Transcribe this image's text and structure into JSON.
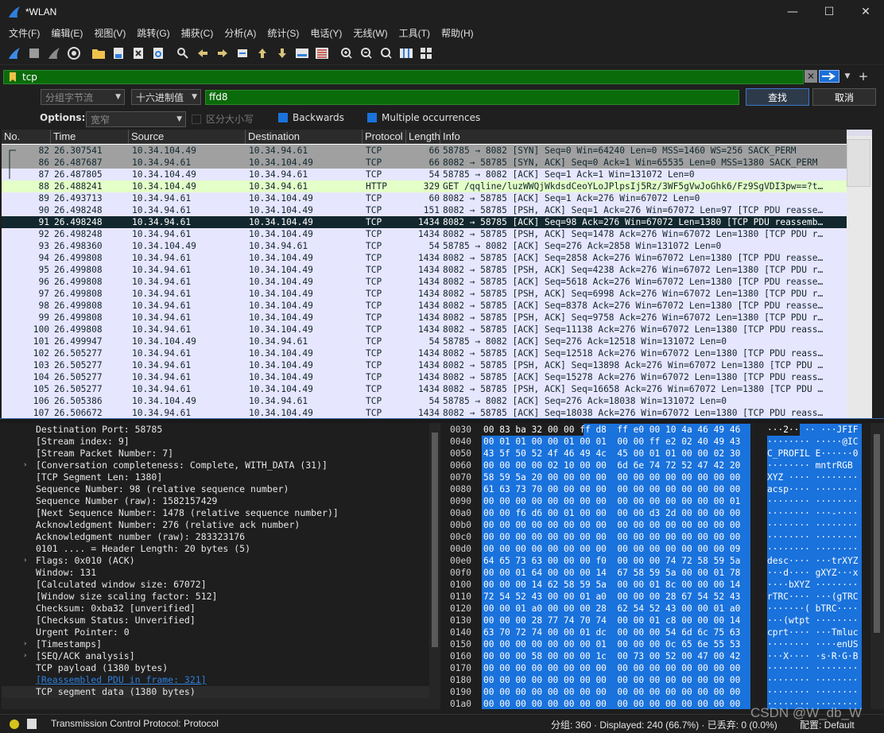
{
  "window": {
    "title": "*WLAN",
    "minimize": "—",
    "maximize": "☐",
    "close": "✕"
  },
  "menu": [
    "文件(F)",
    "编辑(E)",
    "视图(V)",
    "跳转(G)",
    "捕获(C)",
    "分析(A)",
    "统计(S)",
    "电话(Y)",
    "无线(W)",
    "工具(T)",
    "帮助(H)"
  ],
  "filter": {
    "value": "tcp"
  },
  "find": {
    "scope": "分组字节流",
    "type": "十六进制值",
    "value": "ffd8",
    "find_btn": "查找",
    "cancel_btn": "取消",
    "options_label": "Options:",
    "charset": "宽窄",
    "case_label": "区分大小写",
    "backwards_label": "Backwards",
    "multiple_label": "Multiple occurrences"
  },
  "columns": [
    "No.",
    "Time",
    "Source",
    "Destination",
    "Protocol",
    "Length",
    "Info"
  ],
  "packets": [
    {
      "no": "82",
      "time": "26.307541",
      "src": "10.34.104.49",
      "dst": "10.34.94.61",
      "proto": "TCP",
      "len": "66",
      "info": "58785 → 8082 [SYN] Seq=0 Win=64240 Len=0 MSS=1460 WS=256 SACK_PERM",
      "style": "gray"
    },
    {
      "no": "86",
      "time": "26.487687",
      "src": "10.34.94.61",
      "dst": "10.34.104.49",
      "proto": "TCP",
      "len": "66",
      "info": "8082 → 58785 [SYN, ACK] Seq=0 Ack=1 Win=65535 Len=0 MSS=1380 SACK_PERM",
      "style": "gray"
    },
    {
      "no": "87",
      "time": "26.487805",
      "src": "10.34.104.49",
      "dst": "10.34.94.61",
      "proto": "TCP",
      "len": "54",
      "info": "58785 → 8082 [ACK] Seq=1 Ack=1 Win=131072 Len=0",
      "style": "tcp"
    },
    {
      "no": "88",
      "time": "26.488241",
      "src": "10.34.104.49",
      "dst": "10.34.94.61",
      "proto": "HTTP",
      "len": "329",
      "info": "GET /qqline/luzWWQjWkdsdCeoYLoJPlpsIj5Rz/3WF5gVwJoGhk6/Fz9SgVDI3pw==?t…",
      "style": "http"
    },
    {
      "no": "89",
      "time": "26.493713",
      "src": "10.34.94.61",
      "dst": "10.34.104.49",
      "proto": "TCP",
      "len": "60",
      "info": "8082 → 58785 [ACK] Seq=1 Ack=276 Win=67072 Len=0",
      "style": "tcp"
    },
    {
      "no": "90",
      "time": "26.498248",
      "src": "10.34.94.61",
      "dst": "10.34.104.49",
      "proto": "TCP",
      "len": "151",
      "info": "8082 → 58785 [PSH, ACK] Seq=1 Ack=276 Win=67072 Len=97 [TCP PDU reasse…",
      "style": "tcp"
    },
    {
      "no": "91",
      "time": "26.498248",
      "src": "10.34.94.61",
      "dst": "10.34.104.49",
      "proto": "TCP",
      "len": "1434",
      "info": "8082 → 58785 [ACK] Seq=98 Ack=276 Win=67072 Len=1380 [TCP PDU reassemb…",
      "style": "selected"
    },
    {
      "no": "92",
      "time": "26.498248",
      "src": "10.34.94.61",
      "dst": "10.34.104.49",
      "proto": "TCP",
      "len": "1434",
      "info": "8082 → 58785 [PSH, ACK] Seq=1478 Ack=276 Win=67072 Len=1380 [TCP PDU r…",
      "style": "tcp"
    },
    {
      "no": "93",
      "time": "26.498360",
      "src": "10.34.104.49",
      "dst": "10.34.94.61",
      "proto": "TCP",
      "len": "54",
      "info": "58785 → 8082 [ACK] Seq=276 Ack=2858 Win=131072 Len=0",
      "style": "tcp"
    },
    {
      "no": "94",
      "time": "26.499808",
      "src": "10.34.94.61",
      "dst": "10.34.104.49",
      "proto": "TCP",
      "len": "1434",
      "info": "8082 → 58785 [ACK] Seq=2858 Ack=276 Win=67072 Len=1380 [TCP PDU reasse…",
      "style": "tcp"
    },
    {
      "no": "95",
      "time": "26.499808",
      "src": "10.34.94.61",
      "dst": "10.34.104.49",
      "proto": "TCP",
      "len": "1434",
      "info": "8082 → 58785 [PSH, ACK] Seq=4238 Ack=276 Win=67072 Len=1380 [TCP PDU r…",
      "style": "tcp"
    },
    {
      "no": "96",
      "time": "26.499808",
      "src": "10.34.94.61",
      "dst": "10.34.104.49",
      "proto": "TCP",
      "len": "1434",
      "info": "8082 → 58785 [ACK] Seq=5618 Ack=276 Win=67072 Len=1380 [TCP PDU reasse…",
      "style": "tcp"
    },
    {
      "no": "97",
      "time": "26.499808",
      "src": "10.34.94.61",
      "dst": "10.34.104.49",
      "proto": "TCP",
      "len": "1434",
      "info": "8082 → 58785 [PSH, ACK] Seq=6998 Ack=276 Win=67072 Len=1380 [TCP PDU r…",
      "style": "tcp"
    },
    {
      "no": "98",
      "time": "26.499808",
      "src": "10.34.94.61",
      "dst": "10.34.104.49",
      "proto": "TCP",
      "len": "1434",
      "info": "8082 → 58785 [ACK] Seq=8378 Ack=276 Win=67072 Len=1380 [TCP PDU reasse…",
      "style": "tcp"
    },
    {
      "no": "99",
      "time": "26.499808",
      "src": "10.34.94.61",
      "dst": "10.34.104.49",
      "proto": "TCP",
      "len": "1434",
      "info": "8082 → 58785 [PSH, ACK] Seq=9758 Ack=276 Win=67072 Len=1380 [TCP PDU r…",
      "style": "tcp"
    },
    {
      "no": "100",
      "time": "26.499808",
      "src": "10.34.94.61",
      "dst": "10.34.104.49",
      "proto": "TCP",
      "len": "1434",
      "info": "8082 → 58785 [ACK] Seq=11138 Ack=276 Win=67072 Len=1380 [TCP PDU reass…",
      "style": "tcp"
    },
    {
      "no": "101",
      "time": "26.499947",
      "src": "10.34.104.49",
      "dst": "10.34.94.61",
      "proto": "TCP",
      "len": "54",
      "info": "58785 → 8082 [ACK] Seq=276 Ack=12518 Win=131072 Len=0",
      "style": "tcp"
    },
    {
      "no": "102",
      "time": "26.505277",
      "src": "10.34.94.61",
      "dst": "10.34.104.49",
      "proto": "TCP",
      "len": "1434",
      "info": "8082 → 58785 [ACK] Seq=12518 Ack=276 Win=67072 Len=1380 [TCP PDU reass…",
      "style": "tcp"
    },
    {
      "no": "103",
      "time": "26.505277",
      "src": "10.34.94.61",
      "dst": "10.34.104.49",
      "proto": "TCP",
      "len": "1434",
      "info": "8082 → 58785 [PSH, ACK] Seq=13898 Ack=276 Win=67072 Len=1380 [TCP PDU …",
      "style": "tcp"
    },
    {
      "no": "104",
      "time": "26.505277",
      "src": "10.34.94.61",
      "dst": "10.34.104.49",
      "proto": "TCP",
      "len": "1434",
      "info": "8082 → 58785 [ACK] Seq=15278 Ack=276 Win=67072 Len=1380 [TCP PDU reass…",
      "style": "tcp"
    },
    {
      "no": "105",
      "time": "26.505277",
      "src": "10.34.94.61",
      "dst": "10.34.104.49",
      "proto": "TCP",
      "len": "1434",
      "info": "8082 → 58785 [PSH, ACK] Seq=16658 Ack=276 Win=67072 Len=1380 [TCP PDU …",
      "style": "tcp"
    },
    {
      "no": "106",
      "time": "26.505386",
      "src": "10.34.104.49",
      "dst": "10.34.94.61",
      "proto": "TCP",
      "len": "54",
      "info": "58785 → 8082 [ACK] Seq=276 Ack=18038 Win=131072 Len=0",
      "style": "tcp"
    },
    {
      "no": "107",
      "time": "26.506672",
      "src": "10.34.94.61",
      "dst": "10.34.104.49",
      "proto": "TCP",
      "len": "1434",
      "info": "8082 → 58785 [ACK] Seq=18038 Ack=276 Win=67072 Len=1380 [TCP PDU reass…",
      "style": "tcp"
    }
  ],
  "details": [
    {
      "text": "Destination Port: 58785",
      "exp": ""
    },
    {
      "text": "[Stream index: 9]",
      "exp": ""
    },
    {
      "text": "[Stream Packet Number: 7]",
      "exp": ""
    },
    {
      "text": "[Conversation completeness: Complete, WITH_DATA (31)]",
      "exp": "›"
    },
    {
      "text": "[TCP Segment Len: 1380]",
      "exp": ""
    },
    {
      "text": "Sequence Number: 98    (relative sequence number)",
      "exp": ""
    },
    {
      "text": "Sequence Number (raw): 1582157429",
      "exp": ""
    },
    {
      "text": "[Next Sequence Number: 1478    (relative sequence number)]",
      "exp": ""
    },
    {
      "text": "Acknowledgment Number: 276    (relative ack number)",
      "exp": ""
    },
    {
      "text": "Acknowledgment number (raw): 283323176",
      "exp": ""
    },
    {
      "text": "0101 .... = Header Length: 20 bytes (5)",
      "exp": ""
    },
    {
      "text": "Flags: 0x010 (ACK)",
      "exp": "›"
    },
    {
      "text": "Window: 131",
      "exp": ""
    },
    {
      "text": "[Calculated window size: 67072]",
      "exp": ""
    },
    {
      "text": "[Window size scaling factor: 512]",
      "exp": ""
    },
    {
      "text": "Checksum: 0xba32 [unverified]",
      "exp": ""
    },
    {
      "text": "[Checksum Status: Unverified]",
      "exp": ""
    },
    {
      "text": "Urgent Pointer: 0",
      "exp": ""
    },
    {
      "text": "[Timestamps]",
      "exp": "›"
    },
    {
      "text": "[SEQ/ACK analysis]",
      "exp": "›"
    },
    {
      "text": "TCP payload (1380 bytes)",
      "exp": ""
    },
    {
      "text": "[Reassembled PDU in frame: 321]",
      "exp": "",
      "link": true
    },
    {
      "text": "TCP segment data (1380 bytes)",
      "exp": "",
      "sel": true
    }
  ],
  "hex": [
    {
      "off": "0030",
      "bytes": "00 83 ba 32 00 00 ff d8  ff e0 00 10 4a 46 49 46",
      "ascii": "···2·· ·· ···JFIF",
      "hl": 6,
      "ahl": 6
    },
    {
      "off": "0040",
      "bytes": "00 01 01 00 00 01 00 01  00 00 ff e2 02 40 49 43",
      "ascii": "········ ·····@IC",
      "hl": 0,
      "ahl": 0
    },
    {
      "off": "0050",
      "bytes": "43 5f 50 52 4f 46 49 4c  45 00 01 01 00 00 02 30",
      "ascii": "C_PROFIL E······0",
      "hl": 0,
      "ahl": 0
    },
    {
      "off": "0060",
      "bytes": "00 00 00 00 02 10 00 00  6d 6e 74 72 52 47 42 20",
      "ascii": "········ mntrRGB ",
      "hl": 0,
      "ahl": 0
    },
    {
      "off": "0070",
      "bytes": "58 59 5a 20 00 00 00 00  00 00 00 00 00 00 00 00",
      "ascii": "XYZ ···· ········",
      "hl": 0,
      "ahl": 0
    },
    {
      "off": "0080",
      "bytes": "61 63 73 70 00 00 00 00  00 00 00 00 00 00 00 00",
      "ascii": "acsp···· ········",
      "hl": 0,
      "ahl": 0
    },
    {
      "off": "0090",
      "bytes": "00 00 00 00 00 00 00 00  00 00 00 00 00 00 00 01",
      "ascii": "········ ········",
      "hl": 0,
      "ahl": 0
    },
    {
      "off": "00a0",
      "bytes": "00 00 f6 d6 00 01 00 00  00 00 d3 2d 00 00 00 00",
      "ascii": "········ ···-····",
      "hl": 0,
      "ahl": 0
    },
    {
      "off": "00b0",
      "bytes": "00 00 00 00 00 00 00 00  00 00 00 00 00 00 00 00",
      "ascii": "········ ········",
      "hl": 0,
      "ahl": 0
    },
    {
      "off": "00c0",
      "bytes": "00 00 00 00 00 00 00 00  00 00 00 00 00 00 00 00",
      "ascii": "········ ········",
      "hl": 0,
      "ahl": 0
    },
    {
      "off": "00d0",
      "bytes": "00 00 00 00 00 00 00 00  00 00 00 00 00 00 00 09",
      "ascii": "········ ········",
      "hl": 0,
      "ahl": 0
    },
    {
      "off": "00e0",
      "bytes": "64 65 73 63 00 00 00 f0  00 00 00 74 72 58 59 5a",
      "ascii": "desc···· ···trXYZ",
      "hl": 0,
      "ahl": 0
    },
    {
      "off": "00f0",
      "bytes": "00 00 01 64 00 00 00 14  67 58 59 5a 00 00 01 78",
      "ascii": "···d···· gXYZ···x",
      "hl": 0,
      "ahl": 0
    },
    {
      "off": "0100",
      "bytes": "00 00 00 14 62 58 59 5a  00 00 01 8c 00 00 00 14",
      "ascii": "····bXYZ ········",
      "hl": 0,
      "ahl": 0
    },
    {
      "off": "0110",
      "bytes": "72 54 52 43 00 00 01 a0  00 00 00 28 67 54 52 43",
      "ascii": "rTRC···· ···(gTRC",
      "hl": 0,
      "ahl": 0
    },
    {
      "off": "0120",
      "bytes": "00 00 01 a0 00 00 00 28  62 54 52 43 00 00 01 a0",
      "ascii": "·······( bTRC····",
      "hl": 0,
      "ahl": 0
    },
    {
      "off": "0130",
      "bytes": "00 00 00 28 77 74 70 74  00 00 01 c8 00 00 00 14",
      "ascii": "···(wtpt ········",
      "hl": 0,
      "ahl": 0
    },
    {
      "off": "0140",
      "bytes": "63 70 72 74 00 00 01 dc  00 00 00 54 6d 6c 75 63",
      "ascii": "cprt···· ···Tmluc",
      "hl": 0,
      "ahl": 0
    },
    {
      "off": "0150",
      "bytes": "00 00 00 00 00 00 00 01  00 00 00 0c 65 6e 55 53",
      "ascii": "········ ····enUS",
      "hl": 0,
      "ahl": 0
    },
    {
      "off": "0160",
      "bytes": "00 00 00 58 00 00 00 1c  00 73 00 52 00 47 00 42",
      "ascii": "···X···· ·s·R·G·B",
      "hl": 0,
      "ahl": 0
    },
    {
      "off": "0170",
      "bytes": "00 00 00 00 00 00 00 00  00 00 00 00 00 00 00 00",
      "ascii": "········ ········",
      "hl": 0,
      "ahl": 0
    },
    {
      "off": "0180",
      "bytes": "00 00 00 00 00 00 00 00  00 00 00 00 00 00 00 00",
      "ascii": "········ ········",
      "hl": 0,
      "ahl": 0
    },
    {
      "off": "0190",
      "bytes": "00 00 00 00 00 00 00 00  00 00 00 00 00 00 00 00",
      "ascii": "········ ········",
      "hl": 0,
      "ahl": 0
    },
    {
      "off": "01a0",
      "bytes": "00 00 00 00 00 00 00 00  00 00 00 00 00 00 00 00",
      "ascii": "········ ········",
      "hl": 0,
      "ahl": 0
    }
  ],
  "status": {
    "left": "Transmission Control Protocol: Protocol",
    "right": "分组: 360 · Displayed: 240 (66.7%) · 已丢弃: 0 (0.0%)",
    "profile": "配置: Default"
  },
  "watermark": "CSDN @W_db_W",
  "colors": {
    "selected_row": "#12272e",
    "tcp_row": "#e7e6ff",
    "http_row": "#e4ffc7",
    "syn_row": "#a0a0a0",
    "filter_bg": "#0a6b0a",
    "hex_highlight": "#1a72dc"
  }
}
